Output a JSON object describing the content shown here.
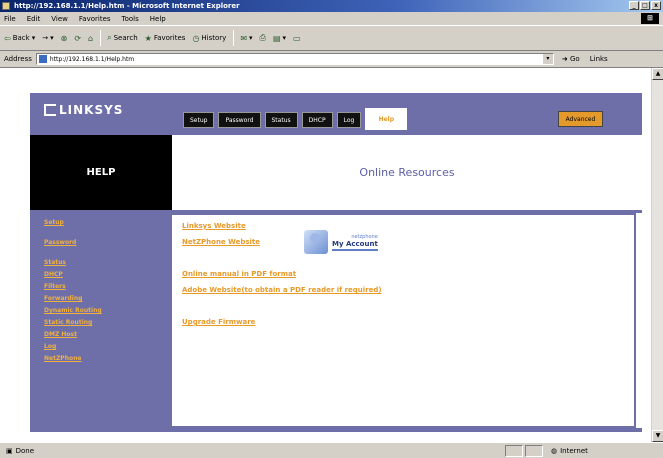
{
  "window": {
    "title": "http://192.168.1.1/Help.htm - Microsoft Internet Explorer",
    "controls": [
      "_",
      "□",
      "x"
    ]
  },
  "menu": {
    "items": [
      "File",
      "Edit",
      "View",
      "Favorites",
      "Tools",
      "Help"
    ]
  },
  "toolbar": {
    "back": "Back",
    "forward": "→",
    "stop_icon": "stop-icon",
    "refresh_icon": "refresh-icon",
    "home_icon": "home-icon",
    "search": "Search",
    "favorites": "Favorites",
    "history": "History"
  },
  "address": {
    "label": "Address",
    "url": "http://192.168.1.1/Help.htm",
    "go": "Go",
    "links": "Links"
  },
  "page": {
    "brand": "LINKSYS",
    "tabs": [
      "Setup",
      "Password",
      "Status",
      "DHCP",
      "Log",
      "Help"
    ],
    "active_tab": "Help",
    "advanced": "Advanced",
    "help_label": "HELP",
    "title": "Online Resources",
    "sidebar": [
      "Setup",
      "Password",
      "Status",
      "DHCP",
      "Filters",
      "Forwarding",
      "Dynamic Routing",
      "Static Routing",
      "DMZ Host",
      "Log",
      "NetZPhone"
    ],
    "links": {
      "linksys_website": "Linksys Website",
      "netzphone_website": "NetZPhone Website",
      "manual_pdf": "Online manual in PDF format",
      "adobe": "Adobe Website(to obtain a PDF reader if required)",
      "upgrade": "Upgrade Firmware"
    },
    "myaccount": {
      "small": "netzphone",
      "big": "My Account"
    }
  },
  "status": {
    "text": "Done",
    "zone": "Internet"
  },
  "colors": {
    "linksys_purple": "#6e6fa8",
    "link_orange": "#e79a2a",
    "title_blue": "#5c5ea6"
  }
}
